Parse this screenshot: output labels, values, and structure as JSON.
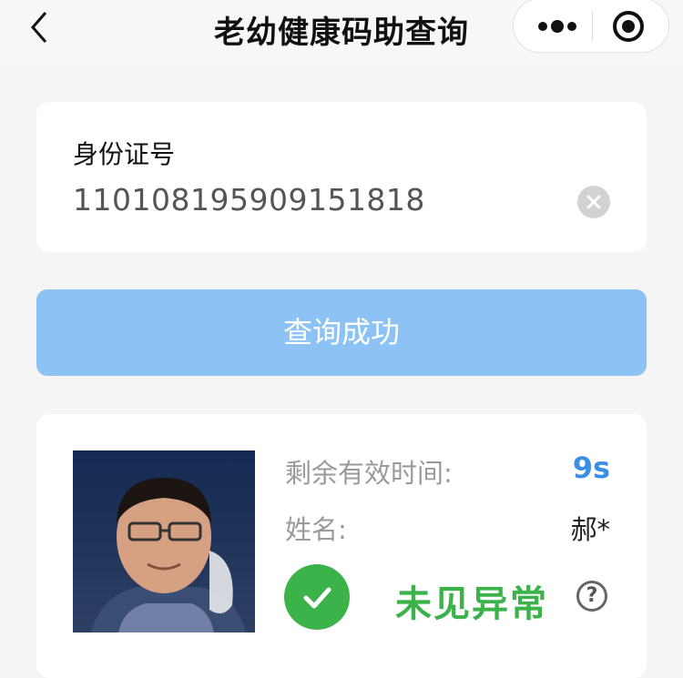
{
  "navbar": {
    "title": "老幼健康码助查询",
    "back_icon": "chevron-left-icon",
    "more_icon": "more-dots-icon",
    "target_icon": "target-circle-icon"
  },
  "id_card": {
    "label": "身份证号",
    "value": "110108195909151818"
  },
  "query_button": {
    "label": "查询成功"
  },
  "result": {
    "remaining_label": "剩余有效时间:",
    "remaining_value": "9s",
    "name_label": "姓名:",
    "name_value": "郝*",
    "status_text": "未见异常",
    "help_symbol": "?"
  },
  "colors": {
    "accent_blue": "#3a8ee6",
    "button_blue": "#8cc2f4",
    "status_green": "#3bb24a"
  }
}
